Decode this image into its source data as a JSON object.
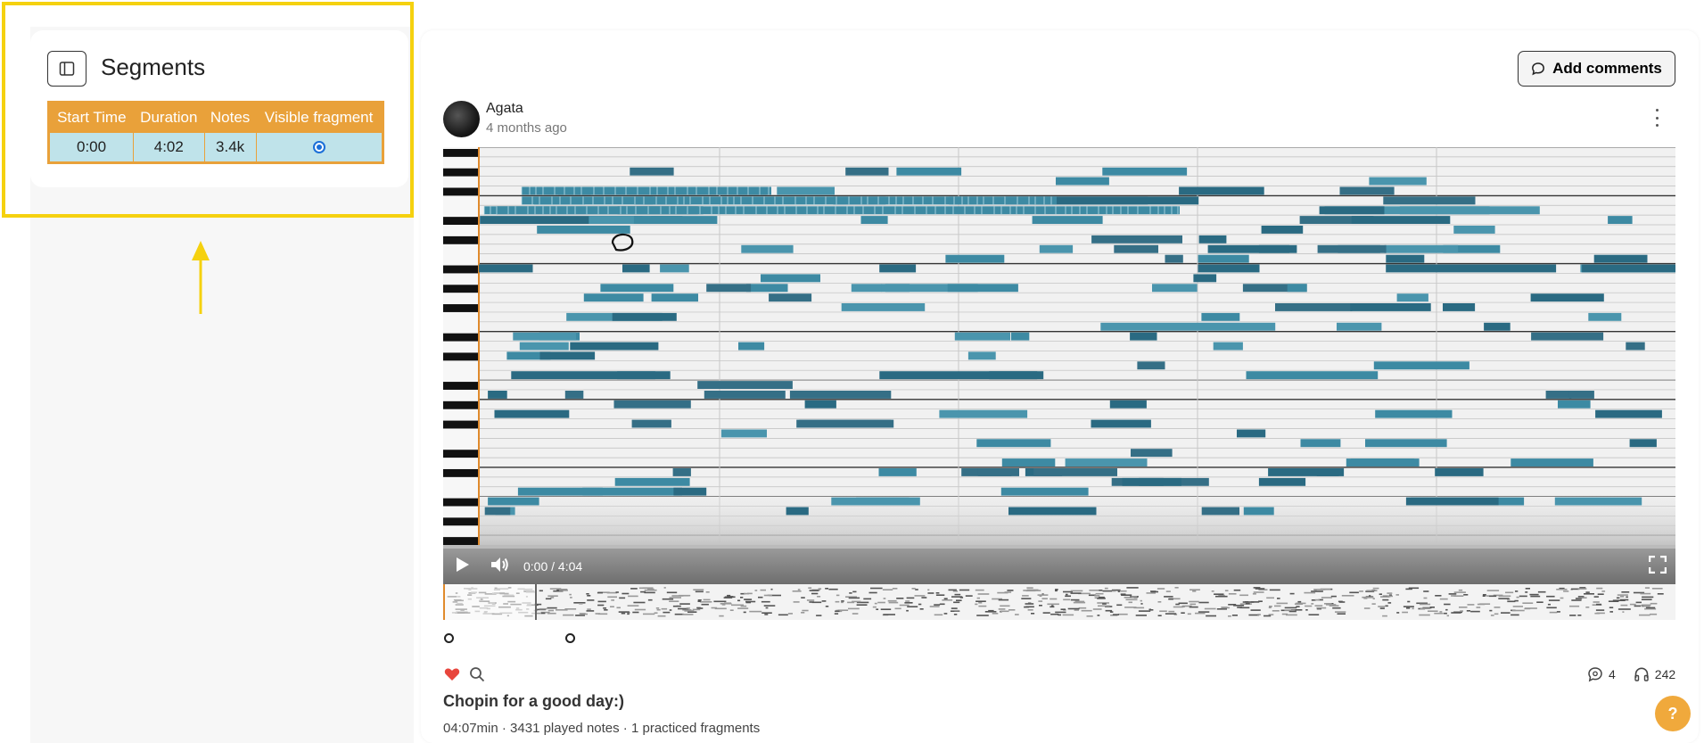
{
  "segments_panel": {
    "title": "Segments",
    "table": {
      "headers": [
        "Start Time",
        "Duration",
        "Notes",
        "Visible fragment"
      ],
      "rows": [
        {
          "start_time": "0:00",
          "duration": "4:02",
          "notes": "3.4k",
          "visible_fragment_selected": true
        }
      ]
    }
  },
  "header": {
    "add_comments_label": "Add comments"
  },
  "post": {
    "author": "Agata",
    "posted": "4 months ago"
  },
  "player": {
    "time": "0:00 / 4:04"
  },
  "footer": {
    "comments_count": "4",
    "listens_count": "242"
  },
  "song": {
    "title": "Chopin for a good day:)",
    "meta": "04:07min · 3431 played notes · 1 practiced fragments"
  },
  "help_label": "?",
  "colors": {
    "highlight": "#f5d10f",
    "table_header": "#e9a13a",
    "table_cell": "#bfe3ea",
    "note": "#3d8aa3",
    "note_dark": "#2a6a82",
    "heart": "#e8453c",
    "help": "#f0a93c"
  }
}
